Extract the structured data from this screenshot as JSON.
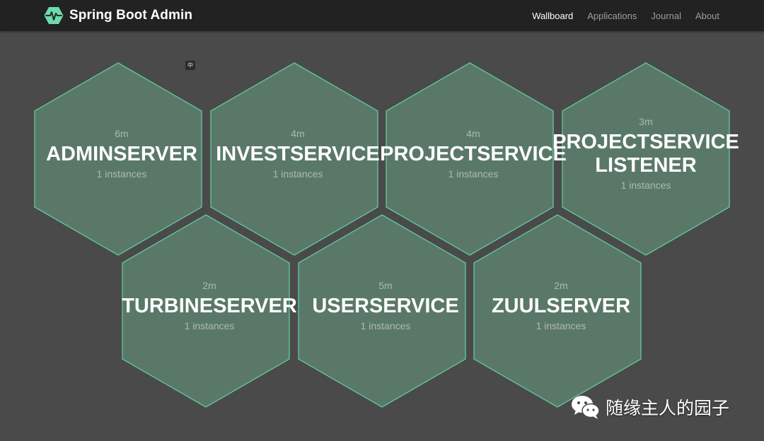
{
  "header": {
    "brand": "Spring Boot Admin",
    "logo_icon": "heartbeat-hexagon-icon",
    "nav": [
      {
        "label": "Wallboard",
        "active": true
      },
      {
        "label": "Applications",
        "active": false
      },
      {
        "label": "Journal",
        "active": false
      },
      {
        "label": "About",
        "active": false
      }
    ]
  },
  "ime_indicator": "中",
  "applications": [
    {
      "name": "ADMINSERVER",
      "uptime": "6m",
      "instances": "1 instances"
    },
    {
      "name": "INVESTSERVICE",
      "uptime": "4m",
      "instances": "1 instances"
    },
    {
      "name": "PROJECTSERVICE",
      "uptime": "4m",
      "instances": "1 instances"
    },
    {
      "name": "PROJECTSERVICE LISTENER",
      "uptime": "3m",
      "instances": "1 instances"
    },
    {
      "name": "TURBINESERVER",
      "uptime": "2m",
      "instances": "1 instances"
    },
    {
      "name": "USERSERVICE",
      "uptime": "5m",
      "instances": "1 instances"
    },
    {
      "name": "ZUULSERVER",
      "uptime": "2m",
      "instances": "1 instances"
    }
  ],
  "watermark": {
    "text": "随缘主人的园子",
    "icon": "wechat-icon"
  },
  "colors": {
    "background": "#4a4a4a",
    "navbar": "#222222",
    "hex_fill": "#5a7868",
    "hex_stroke": "#62c8a0",
    "brand_accent": "#6ddbaf"
  }
}
